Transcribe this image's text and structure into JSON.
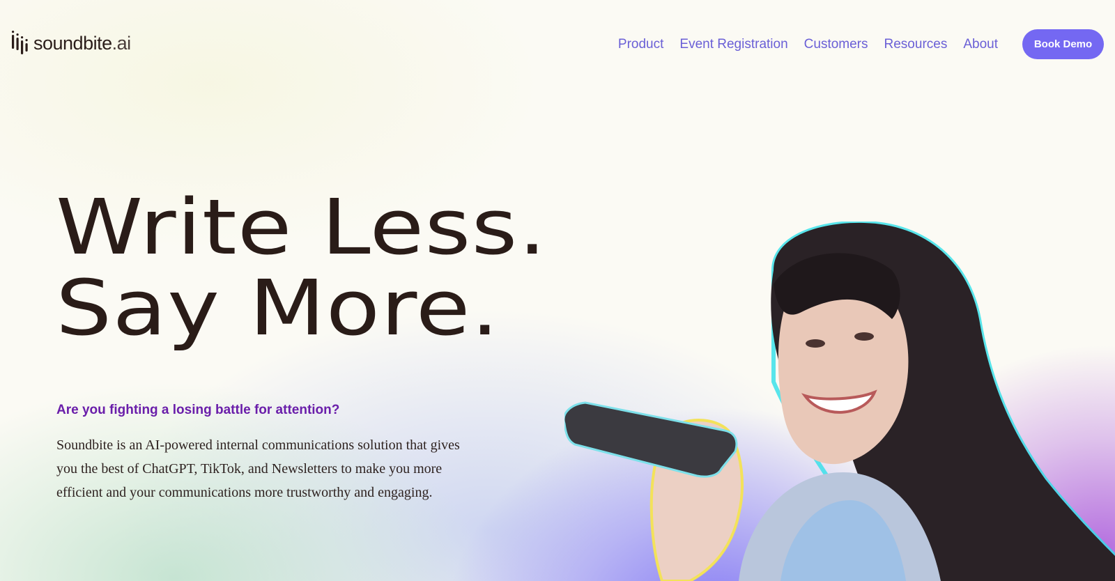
{
  "header": {
    "logo_text": "soundbite",
    "logo_suffix": ".ai",
    "nav_items": [
      "Product",
      "Event Registration",
      "Customers",
      "Resources",
      "About"
    ],
    "cta_label": "Book Demo"
  },
  "hero": {
    "headline_line1": "Write Less.",
    "headline_line2": "Say More.",
    "subheading": "Are you fighting a losing battle for attention?",
    "description": "Soundbite is an AI-powered internal communications solution that gives you the best of ChatGPT, TikTok, and Newsletters to make you more efficient and your communications more trustworthy and engaging.",
    "image_icon": "woman-speaking-into-phone-photo"
  },
  "colors": {
    "accent": "#7468f2",
    "nav_link": "#6a5fd6",
    "subheading": "#6a1eaa",
    "headline": "#2a1c18"
  }
}
